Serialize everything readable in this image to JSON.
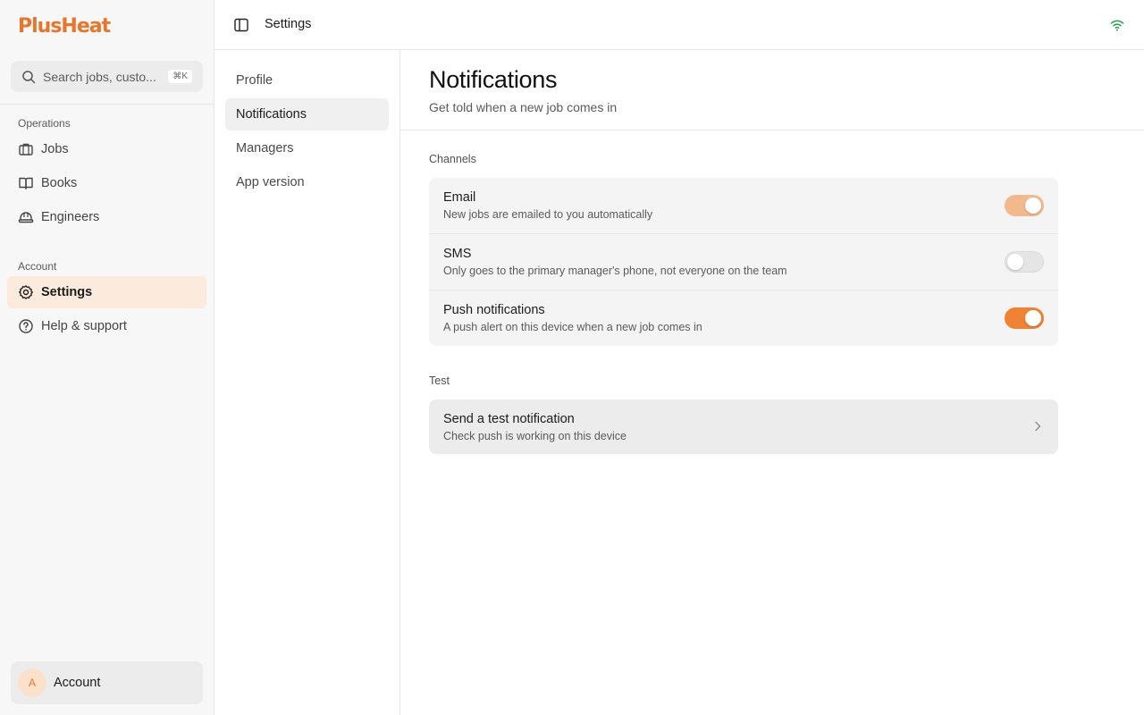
{
  "brand": {
    "name": "PlusHeat",
    "accent": "#ef8333"
  },
  "search": {
    "placeholder": "Search jobs, custo...",
    "shortcut": "⌘K"
  },
  "sidebar": {
    "operations_label": "Operations",
    "operations": [
      {
        "label": "Jobs",
        "icon": "briefcase-icon"
      },
      {
        "label": "Books",
        "icon": "book-icon"
      },
      {
        "label": "Engineers",
        "icon": "hard-hat-icon"
      }
    ],
    "account_label": "Account",
    "account_items": [
      {
        "label": "Settings",
        "icon": "gear-icon",
        "active": true
      },
      {
        "label": "Help & support",
        "icon": "help-circle-icon"
      }
    ],
    "account_footer": {
      "avatar_initial": "A",
      "label": "Account"
    }
  },
  "topbar": {
    "title": "Settings",
    "status_icon": "wifi-icon"
  },
  "settings_nav": [
    {
      "label": "Profile"
    },
    {
      "label": "Notifications",
      "active": true
    },
    {
      "label": "Managers"
    },
    {
      "label": "App version"
    }
  ],
  "page": {
    "title": "Notifications",
    "subtitle": "Get told when a new job comes in",
    "channels_label": "Channels",
    "channels": [
      {
        "title": "Email",
        "description": "New jobs are emailed to you automatically",
        "enabled": true
      },
      {
        "title": "SMS",
        "description": "Only goes to the primary manager's phone, not everyone on the team",
        "enabled": false
      },
      {
        "title": "Push notifications",
        "description": "A push alert on this device when a new job comes in",
        "enabled": true
      }
    ],
    "test_label": "Test",
    "test_action": {
      "title": "Send a test notification",
      "description": "Check push is working on this device"
    }
  }
}
